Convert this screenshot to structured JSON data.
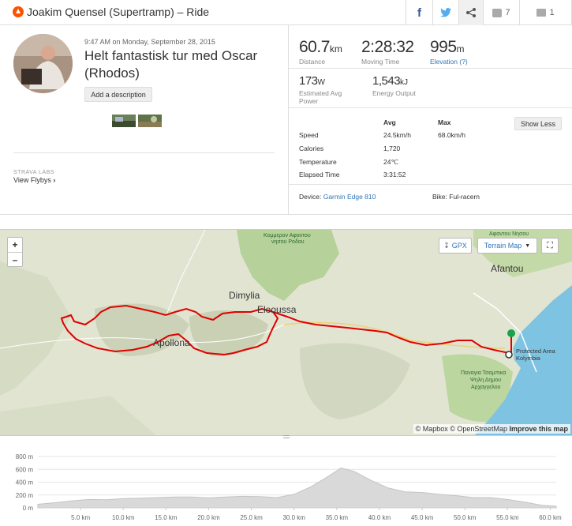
{
  "header": {
    "title": "Joakim Quensel (Supertramp) – Ride",
    "kudos_count": "7",
    "comment_count": "1"
  },
  "activity": {
    "datetime": "9:47 AM on Monday, September 28, 2015",
    "name": "Helt fantastisk tur med Oscar (Rhodos)",
    "add_description": "Add a description",
    "labs": "STRAVA LABS",
    "flyby": "View Flybys"
  },
  "stats": {
    "distance": {
      "value": "60.7",
      "unit": "km",
      "label": "Distance"
    },
    "moving_time": {
      "value": "2:28:32",
      "label": "Moving Time"
    },
    "elevation": {
      "value": "995",
      "unit": "m",
      "label": "Elevation (?)"
    },
    "power": {
      "value": "173",
      "unit": "W",
      "label_line1": "Estimated Avg",
      "label_line2": "Power"
    },
    "energy": {
      "value": "1,543",
      "unit": "kJ",
      "label": "Energy Output"
    }
  },
  "table": {
    "col_avg": "Avg",
    "col_max": "Max",
    "show_less": "Show Less",
    "rows": [
      {
        "label": "Speed",
        "avg": "24.5km/h",
        "max": "68.0km/h"
      },
      {
        "label": "Calories",
        "avg": "1,720",
        "max": ""
      },
      {
        "label": "Temperature",
        "avg": "24℃",
        "max": ""
      },
      {
        "label": "Elapsed Time",
        "avg": "3:31:52",
        "max": ""
      }
    ]
  },
  "device": {
    "label": "Device:",
    "name": "Garmin Edge 810",
    "bike_label": "Bike:",
    "bike": "Ful-racern"
  },
  "map": {
    "zoom_in": "+",
    "zoom_out": "–",
    "gpx": "GPX",
    "terrain": "Terrain Map",
    "places": {
      "afantou": "Afantou",
      "dimylia": "Dimylia",
      "eleoussa": "Eleoussa",
      "apollona": "Apollona",
      "kolymbia1": "Protected Area",
      "kolymbia2": "Kolymbia",
      "park1": "Κομμερον Αφαντου",
      "park2": "νησου Ροδου",
      "afantou_nisou": "Αφαντου Νησου",
      "church1": "Παναγια Τσαμπικα",
      "church2": "Ψηλη Δημου",
      "church3": "Αρχαγγελου"
    },
    "attr_mapbox": "© Mapbox",
    "attr_osm": "© OpenStreetMap",
    "attr_improve": "Improve this map",
    "route_color": "#e00000"
  },
  "elevation_profile": {
    "y_labels": [
      "800 m",
      "600 m",
      "400 m",
      "200 m",
      "0 m"
    ],
    "x_labels": [
      "5.0 km",
      "10.0 km",
      "15.0 km",
      "20.0 km",
      "25.0 km",
      "30.0 km",
      "35.0 km",
      "40.0 km",
      "45.0 km",
      "50.0 km",
      "55.0 km",
      "60.0 km"
    ]
  },
  "chart_data": {
    "type": "area",
    "title": "",
    "xlabel": "",
    "ylabel": "",
    "xlim": [
      0,
      60.7
    ],
    "ylim": [
      0,
      800
    ],
    "x": [
      0,
      2,
      4,
      6,
      8,
      10,
      12,
      14,
      16,
      18,
      20,
      22,
      24,
      26,
      28,
      30,
      32,
      34,
      35.5,
      37,
      39,
      41,
      43,
      45,
      47,
      49,
      51,
      53,
      55,
      57,
      59,
      60.7
    ],
    "values": [
      55,
      80,
      110,
      130,
      125,
      145,
      150,
      160,
      170,
      170,
      155,
      170,
      180,
      175,
      160,
      210,
      330,
      490,
      620,
      570,
      430,
      310,
      250,
      240,
      210,
      190,
      160,
      160,
      130,
      90,
      40,
      25
    ]
  }
}
